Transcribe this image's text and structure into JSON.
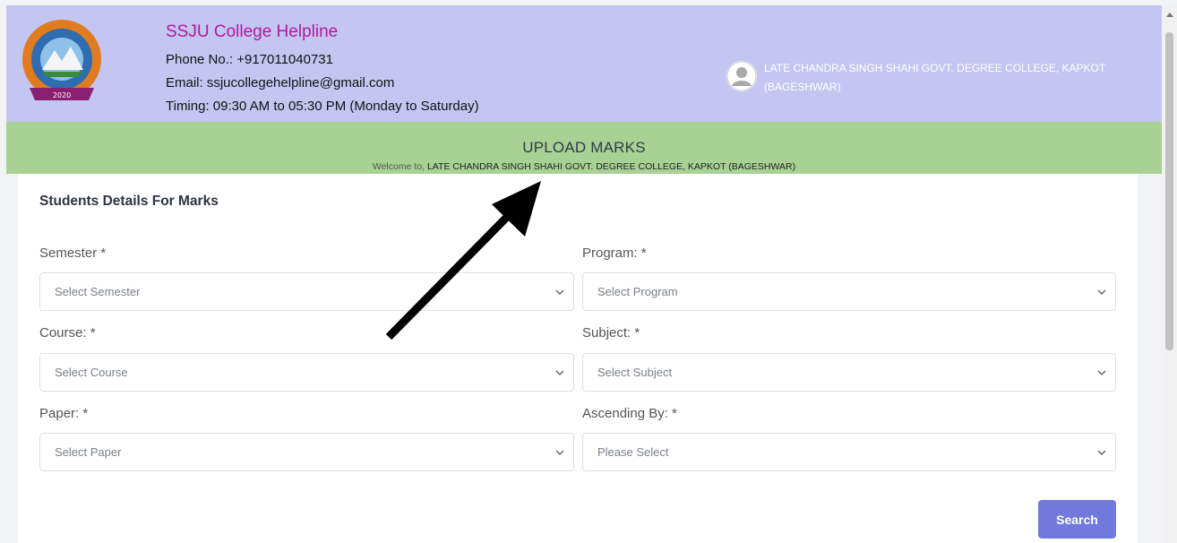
{
  "header": {
    "helpline_title": "SSJU College Helpline",
    "phone": "Phone No.: +917011040731",
    "email": "Email: ssjucollegehelpline@gmail.com",
    "timing": "Timing: 09:30 AM to 05:30 PM (Monday to Saturday)",
    "college_name": "LATE CHANDRA SINGH SHAHI GOVT. DEGREE COLLEGE, KAPKOT (BAGESHWAR)",
    "logo_year": "2020"
  },
  "banner": {
    "title": "UPLOAD MARKS",
    "welcome_prefix": "Welcome to,",
    "welcome_college": "LATE CHANDRA SINGH SHAHI GOVT. DEGREE COLLEGE, KAPKOT (BAGESHWAR)"
  },
  "form": {
    "title": "Students Details For Marks",
    "semester": {
      "label": "Semester *",
      "selected": "Select Semester"
    },
    "program": {
      "label": "Program: *",
      "selected": "Select Program"
    },
    "course": {
      "label": "Course: *",
      "selected": "Select Course"
    },
    "subject": {
      "label": "Subject: *",
      "selected": "Select Subject"
    },
    "paper": {
      "label": "Paper: *",
      "selected": "Select Paper"
    },
    "ascending": {
      "label": "Ascending By: *",
      "selected": "Please Select"
    },
    "search_label": "Search"
  },
  "colors": {
    "header_bg": "#c3c6f0",
    "banner_bg": "#a7d293",
    "title_accent": "#b5179e",
    "button_bg": "#7179dd"
  },
  "icons": {
    "logo": "university-seal-logo",
    "avatar": "user-avatar-icon",
    "select_caret": "chevron-down-icon",
    "annotation": "black-arrow-annotation"
  }
}
